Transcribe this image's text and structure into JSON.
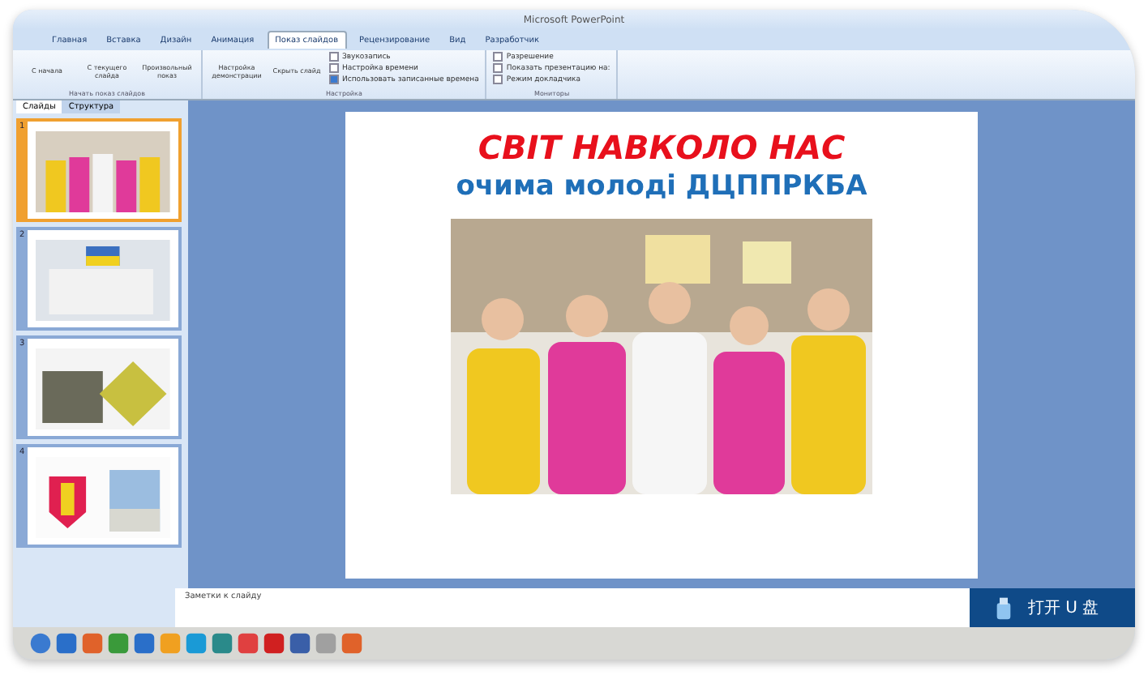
{
  "window": {
    "title": "Microsoft PowerPoint"
  },
  "ribbon_tabs": [
    {
      "label": "Главная",
      "selected": false
    },
    {
      "label": "Вставка",
      "selected": false
    },
    {
      "label": "Дизайн",
      "selected": false
    },
    {
      "label": "Анимация",
      "selected": false
    },
    {
      "label": "Показ слайдов",
      "selected": true
    },
    {
      "label": "Рецензирование",
      "selected": false
    },
    {
      "label": "Вид",
      "selected": false
    },
    {
      "label": "Разработчик",
      "selected": false
    }
  ],
  "ribbon_groups": [
    {
      "label": "Начать показ слайдов",
      "buttons": [
        "С начала",
        "С текущего слайда",
        "Произвольный показ"
      ]
    },
    {
      "label": "Настройка",
      "buttons": [
        "Настройка демонстрации",
        "Скрыть слайд"
      ],
      "options": [
        {
          "label": "Звукозапись",
          "checked": false
        },
        {
          "label": "Настройка времени",
          "checked": false
        },
        {
          "label": "Использовать записанные времена",
          "checked": true
        }
      ]
    },
    {
      "label": "Мониторы",
      "options": [
        {
          "label": "Разрешение",
          "checked": false
        },
        {
          "label": "Показать презентацию на:",
          "checked": false
        },
        {
          "label": "Режим докладчика",
          "checked": false
        }
      ]
    }
  ],
  "pane_tabs": [
    {
      "label": "Слайды",
      "selected": true
    },
    {
      "label": "Структура",
      "selected": false
    }
  ],
  "thumbnails": [
    {
      "number": "1",
      "selected": true,
      "kind": "people"
    },
    {
      "number": "2",
      "selected": false,
      "kind": "building"
    },
    {
      "number": "3",
      "selected": false,
      "kind": "field"
    },
    {
      "number": "4",
      "selected": false,
      "kind": "emblem"
    }
  ],
  "slide": {
    "title": "СВІТ НАВКОЛО НАС",
    "subtitle": "очима молоді ДЦППРКБА"
  },
  "notes": {
    "placeholder": "Заметки к слайду"
  },
  "notification": {
    "text": "打开 U 盘"
  },
  "taskbar": {
    "apps": [
      {
        "color": "#2a6fc9"
      },
      {
        "color": "#e0622a"
      },
      {
        "color": "#3a9a3a"
      },
      {
        "color": "#2a6fc9"
      },
      {
        "color": "#f0a020"
      },
      {
        "color": "#1a9ad6"
      },
      {
        "color": "#2a8a8a"
      },
      {
        "color": "#e04040"
      },
      {
        "color": "#d02020"
      },
      {
        "color": "#3a5fa8"
      },
      {
        "color": "#a0a0a0"
      },
      {
        "color": "#e0622a"
      }
    ]
  }
}
